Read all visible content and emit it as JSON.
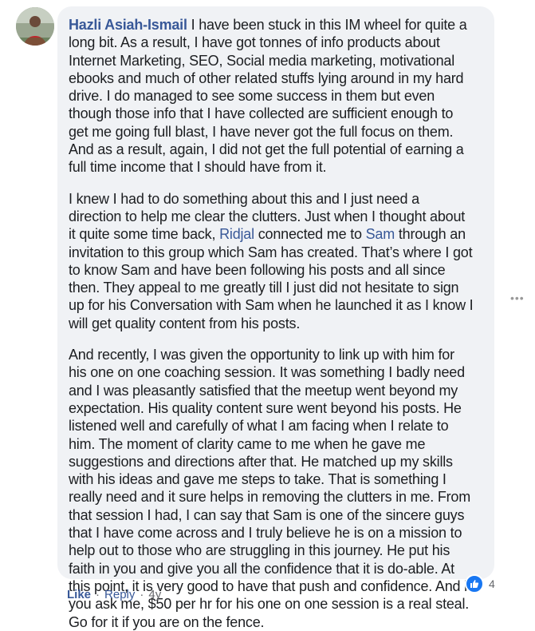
{
  "comment": {
    "author": "Hazli Asiah-Ismail",
    "p1": " I have been stuck in this IM wheel for quite a long bit. As a result, I have got tonnes of info products about Internet Marketing, SEO, Social media marketing, motivational ebooks and much of other related stuffs lying around in my hard drive. I do managed to see some success in them but even though those info that I have collected are sufficient enough to get me going full blast, I have never got the full focus on them. And as a result, again, I did not get the full potential of earning a full time income that I should have from it.",
    "p2_a": "I knew I had to do something about this and I just need a direction to help me clear the clutters. Just when I thought about it quite some time back, ",
    "mention1": "Ridjal",
    "p2_b": " connected me to ",
    "mention2": "Sam",
    "p2_c": " through an invitation to this group which Sam has created. That’s where I got to know Sam and have been following his posts and all since then. They appeal to me greatly till I just did not hesitate to sign up for his Conversation with Sam when he launched it as I know I will get quality content from his posts.",
    "p3": "And recently, I was given the opportunity to link up with him for his one on one coaching session. It was something I badly need and I was pleasantly satisfied that the meetup went beyond my expectation. His quality content sure went beyond his posts. He listened well and carefully of what I am facing when I relate to him. The moment of clarity came to me when he gave me suggestions and directions after that. He matched up my skills with his ideas and gave me steps to take. That is something I really need and it sure helps in removing the clutters in me. From that session I had, I can say that Sam is one of the sincere guys that I have come across and I truly believe he is on a mission to help out to those who are struggling in this journey. He put his faith in you and give you all the confidence that it is do-able. At this point, it is very good to have that push and confidence. And if you ask me, $50 per hr for his one on one session is a real steal. Go for it if you are on the fence."
  },
  "reactions": {
    "icon": "like-icon",
    "count": "4"
  },
  "actions": {
    "like": "Like",
    "reply": "Reply",
    "separator": "·",
    "age": "4y"
  },
  "more_icon": "more-options-icon",
  "colors": {
    "link": "#385898",
    "bubble": "#f0f2f5",
    "like_badge": "#1877f2",
    "meta": "#65676b"
  }
}
